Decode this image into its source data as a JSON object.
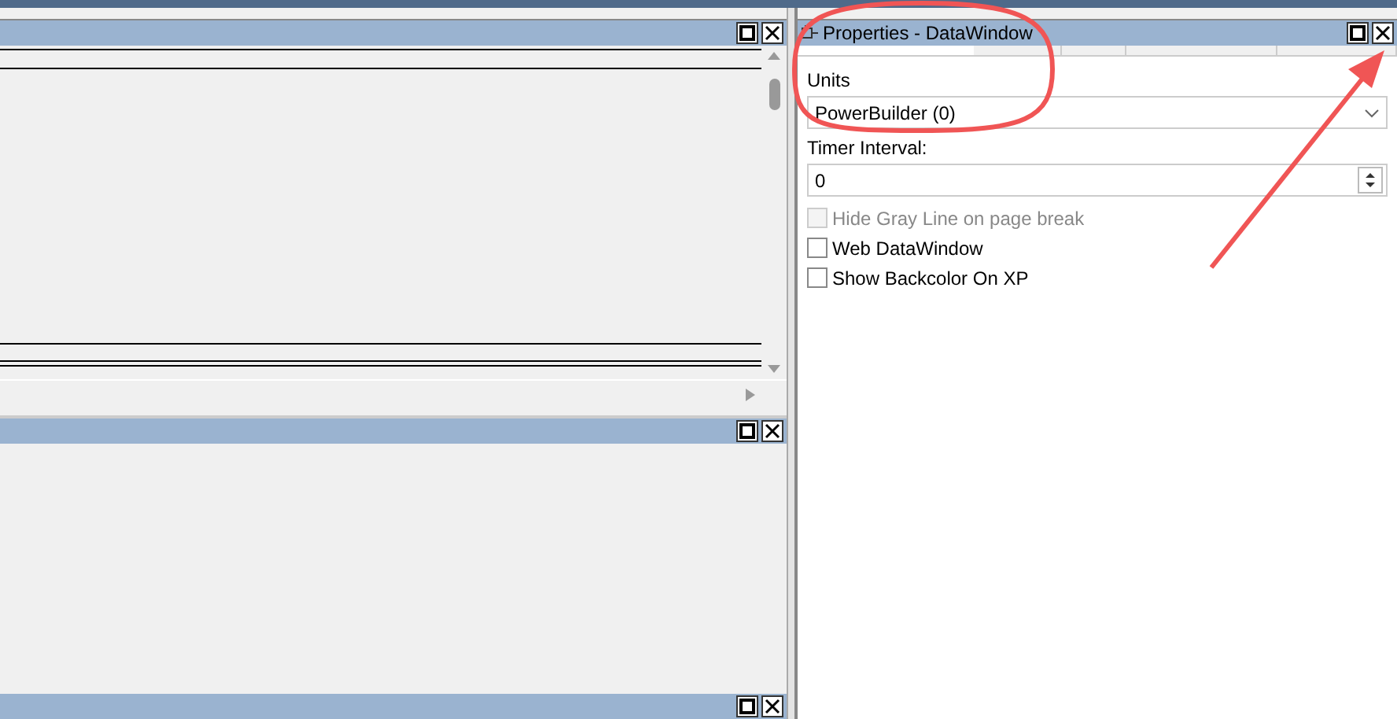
{
  "properties": {
    "title": "Properties -  DataWindow",
    "units": {
      "label": "Units",
      "value": "PowerBuilder (0)"
    },
    "timer": {
      "label": "Timer Interval:",
      "value": "0"
    },
    "options": [
      {
        "label": "Hide Gray Line on page break",
        "checked": false,
        "disabled": true
      },
      {
        "label": "Web DataWindow",
        "checked": false,
        "disabled": false
      },
      {
        "label": "Show Backcolor On XP",
        "checked": false,
        "disabled": false
      }
    ]
  }
}
